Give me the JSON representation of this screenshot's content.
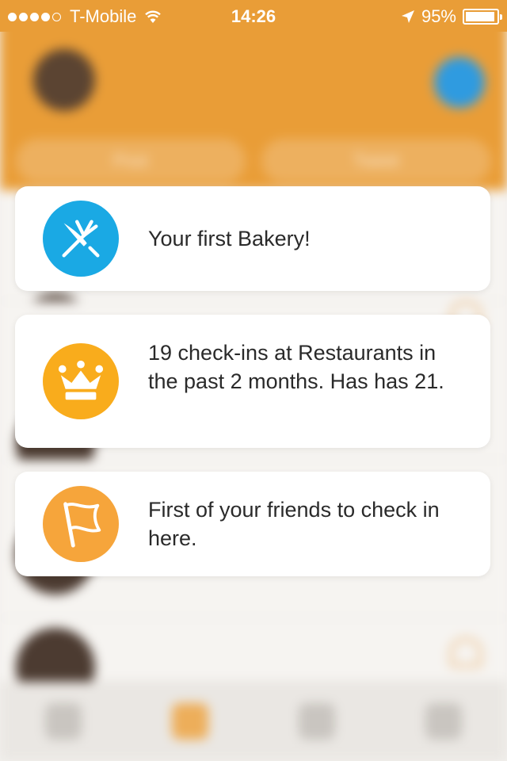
{
  "status_bar": {
    "carrier": "T-Mobile",
    "time": "14:26",
    "battery": "95%",
    "battery_level": 0.95
  },
  "background": {
    "header_buttons": [
      "Post",
      "Tweet"
    ]
  },
  "colors": {
    "header": "#e99d37",
    "category_icon": "#1aa9e4",
    "crown_icon": "#f9ac1c",
    "flag_icon": "#f6a53b"
  },
  "cards": [
    {
      "icon": "fork-knife-icon",
      "text": "Your first Bakery!"
    },
    {
      "icon": "crown-icon",
      "text": "19 check-ins at Restaurants in the past 2 months. Has has 21."
    },
    {
      "icon": "flag-icon",
      "text": "First of your friends to check in here."
    }
  ]
}
